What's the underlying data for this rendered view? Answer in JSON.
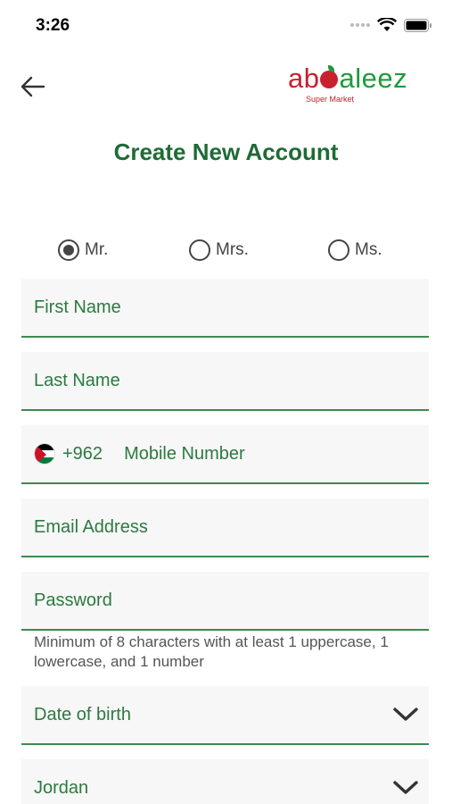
{
  "status_bar": {
    "time": "3:26",
    "icons": [
      "cellular-dots-icon",
      "wifi-icon",
      "battery-icon"
    ]
  },
  "header": {
    "back_icon": "arrow-left-icon",
    "logo": {
      "part1": "ab",
      "part2": "aleez",
      "subtitle": "Super Market",
      "colors": {
        "red": "#c8202f",
        "green": "#1f9a3c"
      }
    }
  },
  "title": "Create New Account",
  "salutations": [
    {
      "label": "Mr.",
      "checked": true
    },
    {
      "label": "Mrs.",
      "checked": false
    },
    {
      "label": "Ms.",
      "checked": false
    }
  ],
  "fields": {
    "first_name": "First Name",
    "last_name": "Last Name",
    "phone_code": "+962",
    "mobile": "Mobile Number",
    "email": "Email Address",
    "password": "Password",
    "password_hint": "Minimum of 8 characters with at least 1 uppercase, 1 lowercase, and 1 number",
    "dob": "Date of birth",
    "country": "Jordan"
  },
  "colors": {
    "accent_green": "#1e6b35",
    "field_label": "#2b7a3f",
    "underline": "#3d8b4f"
  }
}
